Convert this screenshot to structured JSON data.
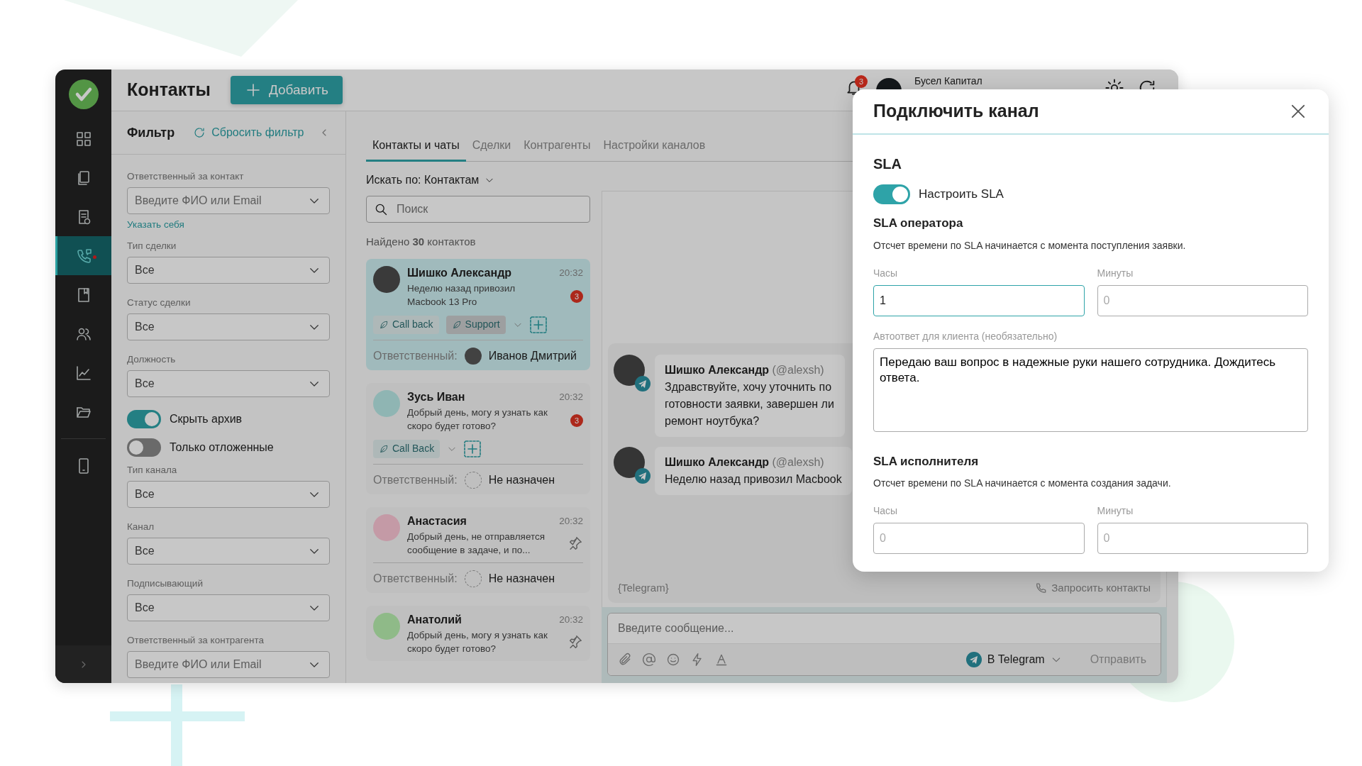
{
  "sidebar": {
    "items": [
      {
        "selected": false,
        "dot": false
      },
      {
        "selected": false,
        "dot": false
      },
      {
        "selected": false,
        "dot": false
      },
      {
        "selected": true,
        "dot": true
      },
      {
        "selected": false,
        "dot": false
      },
      {
        "selected": false,
        "dot": false
      },
      {
        "selected": false,
        "dot": false
      },
      {
        "selected": false,
        "dot": false
      },
      {
        "selected": false,
        "dot": false
      }
    ]
  },
  "header": {
    "title": "Контакты",
    "add_button": "Добавить",
    "notifications": "3",
    "account": "Бусел Капитал"
  },
  "filter": {
    "title": "Фильтр",
    "reset": "Сбросить фильтр",
    "fields": [
      {
        "kind": "select",
        "label": "Ответственный за контакт",
        "placeholder": "Введите ФИО или Email",
        "link": "Указать себя"
      },
      {
        "kind": "select",
        "label": "Тип сделки",
        "value": "Все"
      },
      {
        "kind": "select",
        "label": "Статус сделки",
        "value": "Все"
      },
      {
        "kind": "select",
        "label": "Должность",
        "value": "Все"
      },
      {
        "kind": "toggle",
        "label": "Скрыть архив",
        "on": true
      },
      {
        "kind": "toggle",
        "label": "Только отложенные",
        "on": false
      },
      {
        "kind": "select",
        "label": "Тип канала",
        "value": "Все"
      },
      {
        "kind": "select",
        "label": "Канал",
        "value": "Все"
      },
      {
        "kind": "select",
        "label": "Подписывающий",
        "value": "Все"
      },
      {
        "kind": "select",
        "label": "Ответственный за контрагента",
        "placeholder": "Введите ФИО или Email"
      }
    ]
  },
  "tabs": [
    {
      "label": "Контакты и чаты",
      "selected": true
    },
    {
      "label": "Сделки",
      "selected": false
    },
    {
      "label": "Контрагенты",
      "selected": false
    },
    {
      "label": "Настройки каналов",
      "selected": false
    }
  ],
  "search": {
    "by": "Искать по: Контактам",
    "placeholder": "Поиск"
  },
  "found": "Найдено **30** контактов",
  "contacts": [
    {
      "name": "Шишко Александр",
      "time": "20:32",
      "preview": "Неделю назад привозил Macbook 13 Pro",
      "unread": "3",
      "pinned": false,
      "selected": true,
      "avatar": {
        "kind": "photo"
      },
      "tags": [
        {
          "label": "Call back",
          "selected": false
        },
        {
          "label": "Support",
          "selected": true
        }
      ],
      "responsible_label": "Ответственный:",
      "responsible": "Иванов Дмитрий",
      "assigned": true
    },
    {
      "name": "Зусь Иван",
      "time": "20:32",
      "preview": "Добрый день, могу я узнать как скоро будет готово?",
      "unread": "3",
      "pinned": false,
      "selected": false,
      "avatar": {
        "kind": "cartoon",
        "color": "#8fb5b3"
      },
      "tags": [
        {
          "label": "Call Back",
          "selected": false
        }
      ],
      "responsible_label": "Ответственный:",
      "responsible": "Не назначен",
      "assigned": false
    },
    {
      "name": "Анастасия",
      "time": "20:32",
      "preview": "Добрый день, не отправляется сообщение в задаче, и по...",
      "pinned": true,
      "selected": false,
      "avatar": {
        "kind": "cartoon",
        "color": "#c49aa6"
      },
      "responsible_label": "Ответственный:",
      "responsible": "Не назначен",
      "assigned": false
    },
    {
      "name": "Анатолий",
      "time": "20:32",
      "preview": "Добрый день, могу я узнать как скоро будет готово?",
      "pinned": true,
      "selected": false,
      "avatar": {
        "kind": "cartoon",
        "color": "#8fba88"
      }
    }
  ],
  "chat": {
    "messages": [
      {
        "author": "Шишко Александр",
        "handle": "(@alexsh)",
        "text": "Здравствуйте, хочу уточнить по готовности заявки, завершен ли ремонт ноутбука?"
      },
      {
        "author": "Шишко Александр",
        "handle": "(@alexsh)",
        "text": "Неделю назад привозил Macbook"
      }
    ],
    "channel": "{Telegram}",
    "request_contacts": "Запросить контакты",
    "input_placeholder": "Введите сообщение...",
    "send_via": "В Telegram",
    "send": "Отправить"
  },
  "modal": {
    "title": "Подключить канал",
    "section": "SLA",
    "toggle": {
      "label": "Настроить SLA",
      "on": true
    },
    "groups": [
      {
        "title": "SLA оператора",
        "note": "Отсчет времени по SLA начинается с момента поступления заявки.",
        "fields": [
          {
            "label": "Часы",
            "value": "1",
            "focused": true
          },
          {
            "label": "Минуты",
            "placeholder": "0",
            "focused": false
          }
        ],
        "autoreply": {
          "label": "Автоответ для клиента (необязательно)",
          "value": "Передаю ваш вопрос в надежные руки нашего сотрудника. Дождитесь ответа."
        }
      },
      {
        "title": "SLA исполнителя",
        "note": "Отсчет времени по SLA начинается с момента создания задачи.",
        "fields": [
          {
            "label": "Часы",
            "placeholder": "0",
            "focused": false
          },
          {
            "label": "Минуты",
            "placeholder": "0",
            "focused": false
          }
        ]
      }
    ]
  }
}
